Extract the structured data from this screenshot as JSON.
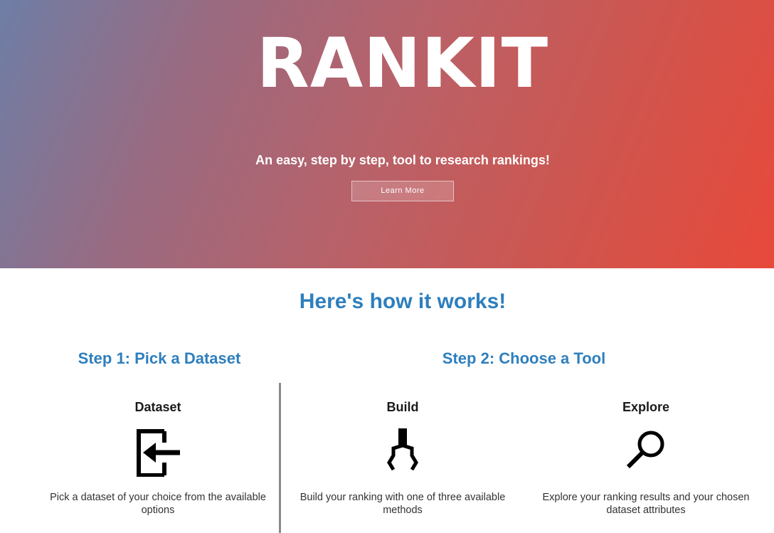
{
  "hero": {
    "title": "RANKIT",
    "subtitle": "An easy, step by step, tool to research rankings!",
    "button_label": "Learn More"
  },
  "how": {
    "title": "Here's how it works!",
    "step1_heading": "Step 1: Pick a Dataset",
    "step2_heading": "Step 2: Choose a Tool"
  },
  "cards": [
    {
      "title": "Dataset",
      "icon": "dataset-import-icon",
      "description": "Pick a dataset of your choice from the available options"
    },
    {
      "title": "Build",
      "icon": "claw-icon",
      "description": "Build your ranking with one of three available methods"
    },
    {
      "title": "Explore",
      "icon": "magnifier-icon",
      "description": "Explore your ranking results and your chosen dataset attributes"
    }
  ],
  "colors": {
    "accent": "#2e7fbd",
    "hero_gradient_start": "#6e7ea6",
    "hero_gradient_end": "#e8493a"
  }
}
